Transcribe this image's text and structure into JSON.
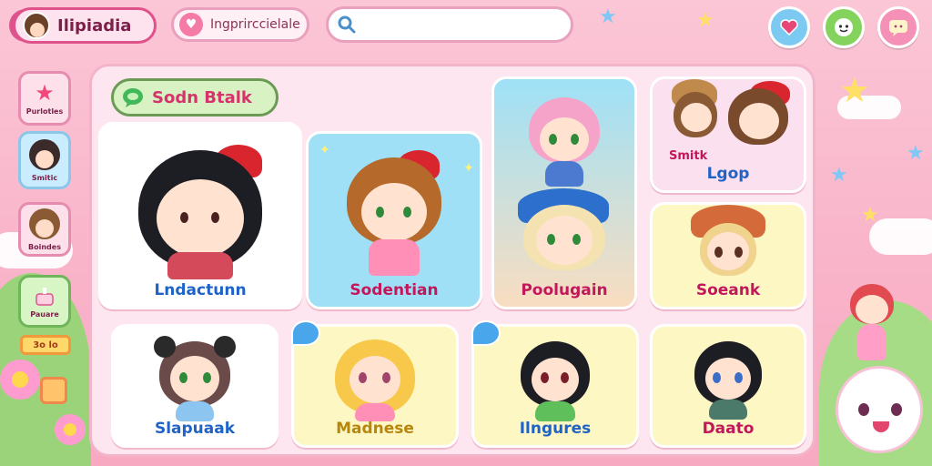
{
  "header": {
    "app_title": "Ilipiadia",
    "tab_label": "Ingprirccielale",
    "search_placeholder": ""
  },
  "sidebar": {
    "items": [
      {
        "label": "Purlotles",
        "icon": "star-icon"
      },
      {
        "label": "Smitic",
        "icon": "avatar-icon"
      },
      {
        "label": "Boindes",
        "icon": "avatar-icon"
      },
      {
        "label": "Pauare",
        "icon": "cake-icon"
      },
      {
        "label": "3o lo",
        "icon": "tag-icon"
      }
    ]
  },
  "panel": {
    "chip_label": "Sodn Btalk"
  },
  "cards": [
    {
      "name": "Lndactunn",
      "name_color": "#1f63c7"
    },
    {
      "name": "Sodentian",
      "name_color": "#c2185b"
    },
    {
      "name": "Poolugain",
      "name_color": "#c2185b"
    },
    {
      "name": "Smitk",
      "name_color": "#c2185b"
    },
    {
      "name": "Lgop",
      "name_color": "#1f63c7"
    },
    {
      "name": "Soeank",
      "name_color": "#c2185b"
    },
    {
      "name": "Slapuaak",
      "name_color": "#1f63c7"
    },
    {
      "name": "Madnese",
      "name_color": "#b8860b"
    },
    {
      "name": "Ilngures",
      "name_color": "#1f63c7"
    },
    {
      "name": "Daato",
      "name_color": "#c2185b"
    }
  ],
  "top_buttons": [
    {
      "icon": "heart-icon",
      "color": "#6fc3f0"
    },
    {
      "icon": "face-icon",
      "color": "#7bcf52"
    },
    {
      "icon": "chat-icon",
      "color": "#f48bb3"
    }
  ]
}
